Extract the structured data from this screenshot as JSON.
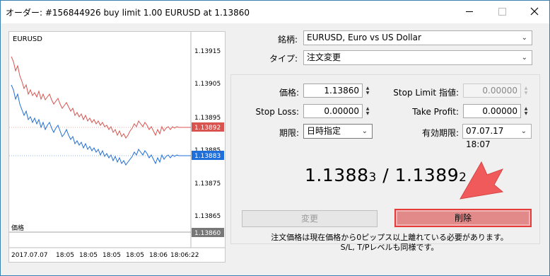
{
  "window": {
    "title": "オーダー: #156844926 buy limit 1.00 EURUSD at 1.13860"
  },
  "chart": {
    "symbol": "EURUSD",
    "price_labels": [
      "1.13915",
      "1.13905",
      "1.13895",
      "1.13885",
      "1.13875",
      "1.13865"
    ],
    "ask_tag": "1.13892",
    "bid_tag": "1.13883",
    "order_tag": "1.13860",
    "order_line_label": "価格",
    "time_labels": [
      "2017.07.07",
      "18:05",
      "18:05",
      "18:05",
      "18:05",
      "18:06",
      "18:06:22"
    ],
    "ask_color": "#d9534f",
    "bid_color": "#1e6fd9"
  },
  "form": {
    "symbol_label": "銘柄:",
    "symbol_value": "EURUSD, Euro vs US Dollar",
    "type_label": "タイプ:",
    "type_value": "注文変更",
    "price_label": "価格:",
    "price_value": "1.13860",
    "stop_limit_label": "Stop Limit 指値:",
    "stop_limit_value": "0.00000",
    "stop_loss_label": "Stop Loss:",
    "stop_loss_value": "0.00000",
    "take_profit_label": "Take Profit:",
    "take_profit_value": "0.00000",
    "expiry_label": "期限:",
    "expiry_value": "日時指定",
    "expiry_date_label": "有効期限:",
    "expiry_date_value": "07.07.17 18:07"
  },
  "quote": {
    "bid_main": "1.1388",
    "bid_small": "3",
    "sep": " / ",
    "ask_main": "1.1389",
    "ask_small": "2"
  },
  "buttons": {
    "modify": "変更",
    "delete": "削除"
  },
  "note": {
    "line1": "注文価格は現在価格から0ピップス以上離れている必要があります。",
    "line2": "S/L, T/Pレベルも同様です。"
  }
}
